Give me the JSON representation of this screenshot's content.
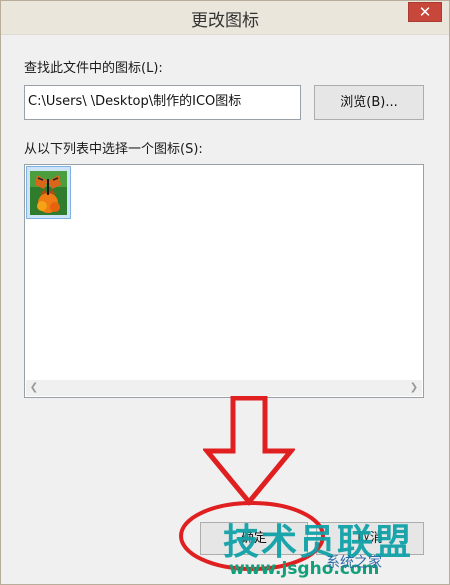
{
  "window": {
    "title": "更改图标",
    "close_glyph": "✕"
  },
  "file_section": {
    "label": "查找此文件中的图标(L):",
    "path_value": "C:\\Users\\        \\Desktop\\制作的ICO图标",
    "browse_label": "浏览(B)..."
  },
  "list_section": {
    "label": "从以下列表中选择一个图标(S):",
    "items": [
      {
        "icon": "butterfly-flower-icon",
        "selected": true
      }
    ]
  },
  "buttons": {
    "ok_label": "确定",
    "cancel_label": "取消"
  },
  "watermark": {
    "brand": "技术员联盟",
    "url": "www.jsgho.com",
    "sub": "系统之家"
  },
  "colors": {
    "annotation_red": "#e02020",
    "selection_blue": "#cde3f7",
    "close_red": "#c7473a"
  }
}
